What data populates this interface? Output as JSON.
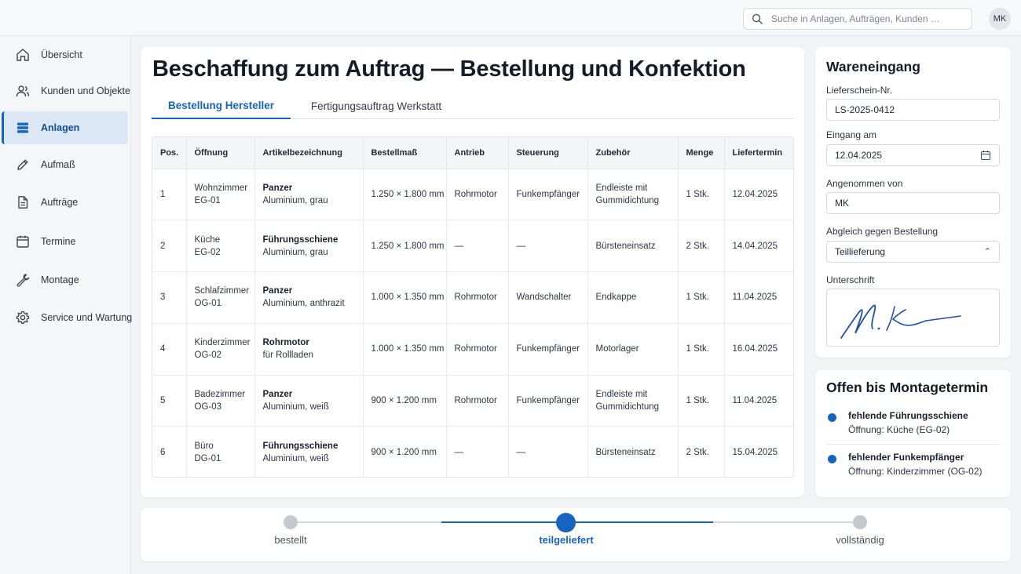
{
  "search": {
    "placeholder": "Suche in Anlagen, Aufträgen, Kunden …"
  },
  "user": {
    "initials": "MK"
  },
  "sidebar": {
    "active": "Anlagen",
    "items": [
      {
        "label": "Übersicht",
        "icon": "home-icon"
      },
      {
        "label": "Kunden und Objekte",
        "icon": "users-icon"
      },
      {
        "label": "Anlagen",
        "icon": "stack-icon"
      },
      {
        "label": "Aufmaß",
        "icon": "pencil-icon"
      },
      {
        "label": "Aufträge",
        "icon": "document-icon"
      },
      {
        "label": "Termine",
        "icon": "calendar-icon"
      },
      {
        "label": "Montage",
        "icon": "wrench-icon"
      },
      {
        "label": "Service und Wartung",
        "icon": "gear-icon"
      }
    ]
  },
  "main": {
    "title": "Beschaffung zum Auftrag — Bestellung und Konfektion",
    "tabs": [
      {
        "label": "Bestellung Hersteller",
        "active": true
      },
      {
        "label": "Fertigungsauftrag Werkstatt",
        "active": false
      }
    ],
    "table": {
      "headers": [
        "Pos.",
        "Öffnung",
        "Artikelbezeichnung",
        "Bestellmaß",
        "Antrieb",
        "Steuerung",
        "Zubehör",
        "Menge",
        "Liefertermin"
      ],
      "rows": [
        {
          "pos": "1",
          "oeffnung": "Wohnzimmer",
          "oeffnung_code": "EG-01",
          "artikel": "Panzer",
          "artikel_detail": "Aluminium, grau",
          "mass": "1.250 × 1.800 mm",
          "antrieb": "Rohrmotor",
          "steuerung": "Funkempfänger",
          "zubehoer": "Endleiste mit Gummidichtung",
          "menge": "1 Stk.",
          "termin": "12.04.2025"
        },
        {
          "pos": "2",
          "oeffnung": "Küche",
          "oeffnung_code": "EG-02",
          "artikel": "Führungsschiene",
          "artikel_detail": "Aluminium, grau",
          "mass": "1.250 × 1.800 mm",
          "antrieb": "—",
          "steuerung": "—",
          "zubehoer": "Bürsteneinsatz",
          "menge": "2 Stk.",
          "termin": "14.04.2025"
        },
        {
          "pos": "3",
          "oeffnung": "Schlafzimmer",
          "oeffnung_code": "OG-01",
          "artikel": "Panzer",
          "artikel_detail": "Aluminium, anthrazit",
          "mass": "1.000 × 1.350 mm",
          "antrieb": "Rohrmotor",
          "steuerung": "Wandschalter",
          "zubehoer": "Endkappe",
          "menge": "1 Stk.",
          "termin": "11.04.2025"
        },
        {
          "pos": "4",
          "oeffnung": "Kinderzimmer",
          "oeffnung_code": "OG-02",
          "artikel": "Rohrmotor",
          "artikel_detail": "für Rollladen",
          "mass": "1.000 × 1.350 mm",
          "antrieb": "Rohrmotor",
          "steuerung": "Funkempfänger",
          "zubehoer": "Motorlager",
          "menge": "1 Stk.",
          "termin": "16.04.2025"
        },
        {
          "pos": "5",
          "oeffnung": "Badezimmer",
          "oeffnung_code": "OG-03",
          "artikel": "Panzer",
          "artikel_detail": "Aluminium, weiß",
          "mass": "900 × 1.200 mm",
          "antrieb": "Rohrmotor",
          "steuerung": "Funkempfänger",
          "zubehoer": "Endleiste mit Gummidichtung",
          "menge": "1 Stk.",
          "termin": "11.04.2025"
        },
        {
          "pos": "6",
          "oeffnung": "Büro",
          "oeffnung_code": "DG-01",
          "artikel": "Führungsschiene",
          "artikel_detail": "Aluminium, weiß",
          "mass": "900 × 1.200 mm",
          "antrieb": "—",
          "steuerung": "—",
          "zubehoer": "Bürsteneinsatz",
          "menge": "2 Stk.",
          "termin": "15.04.2025"
        }
      ]
    }
  },
  "wareneingang": {
    "title": "Wareneingang",
    "lieferschein_label": "Lieferschein-Nr.",
    "lieferschein_value": "LS-2025-0412",
    "eingang_label": "Eingang am",
    "eingang_value": "12.04.2025",
    "angenommen_label": "Angenommen von",
    "angenommen_value": "MK",
    "abgleich_label": "Abgleich gegen Bestellung",
    "abgleich_value": "Teillieferung",
    "unterschrift_label": "Unterschrift"
  },
  "offen": {
    "title": "Offen bis Montagetermin",
    "items": [
      {
        "title": "fehlende Führungsschiene",
        "sub": "Öffnung: Küche (EG-02)"
      },
      {
        "title": "fehlender Funkempfänger",
        "sub": "Öffnung: Kinderzimmer (OG-02)"
      }
    ]
  },
  "progress": {
    "steps": [
      "bestellt",
      "teilgeliefert",
      "vollständig"
    ],
    "current_step": "teilgeliefert"
  },
  "colors": {
    "accent": "#1565c0",
    "background": "#f1f3f6",
    "active_nav_bg": "#dbe7f5"
  }
}
